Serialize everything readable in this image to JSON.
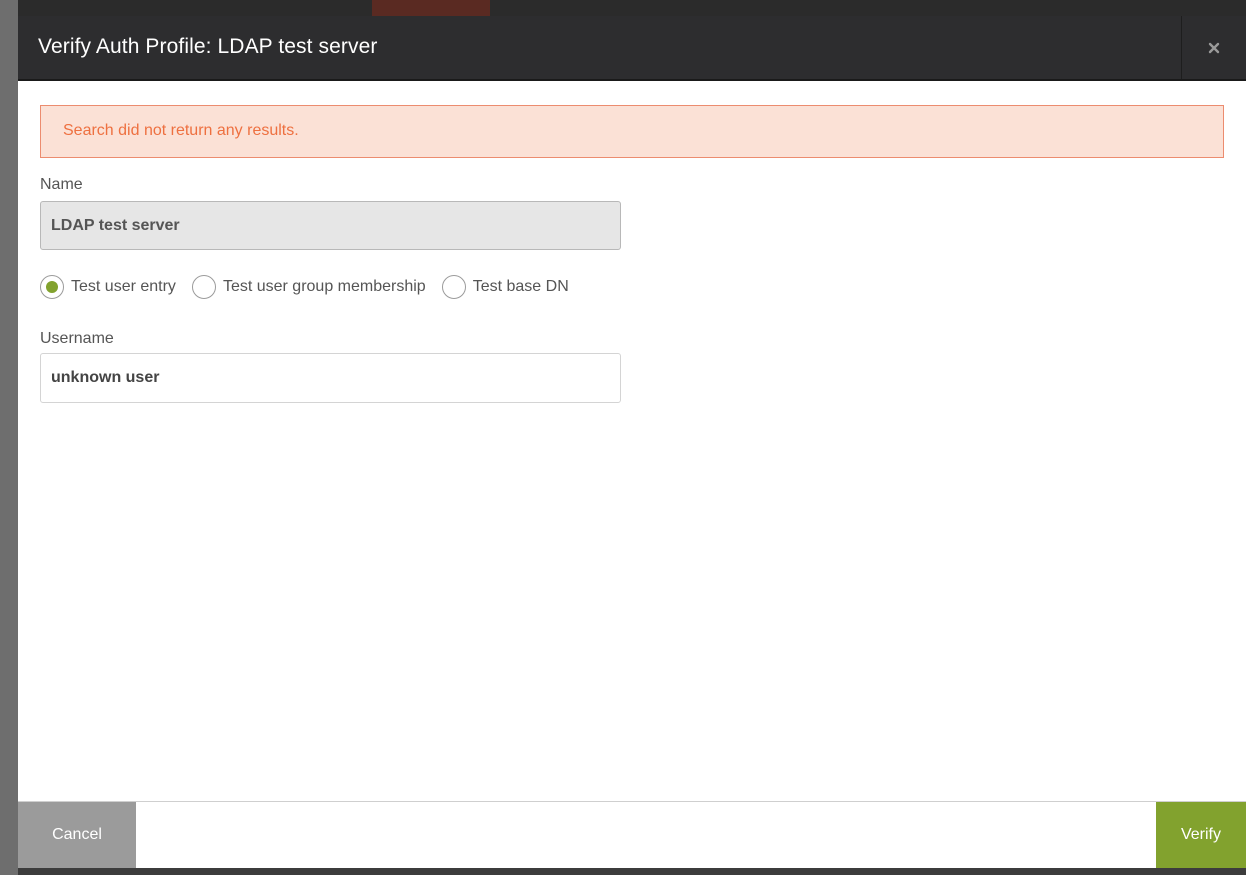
{
  "modal": {
    "title": "Verify Auth Profile: LDAP test server",
    "close_icon": "close-icon"
  },
  "alert": {
    "message": "Search did not return any results.",
    "color": "#ee7040",
    "background": "#fbe1d6"
  },
  "name_field": {
    "label": "Name",
    "value": "LDAP test server",
    "readonly": true
  },
  "test_type": {
    "options": [
      {
        "label": "Test user entry",
        "checked": true
      },
      {
        "label": "Test user group membership",
        "checked": false
      },
      {
        "label": "Test base DN",
        "checked": false
      }
    ]
  },
  "username_field": {
    "label": "Username",
    "value": "unknown user"
  },
  "footer": {
    "cancel_label": "Cancel",
    "verify_label": "Verify"
  },
  "colors": {
    "accent": "#82a22e",
    "header": "#2d2d2f",
    "cancel": "#9b9b9b"
  }
}
